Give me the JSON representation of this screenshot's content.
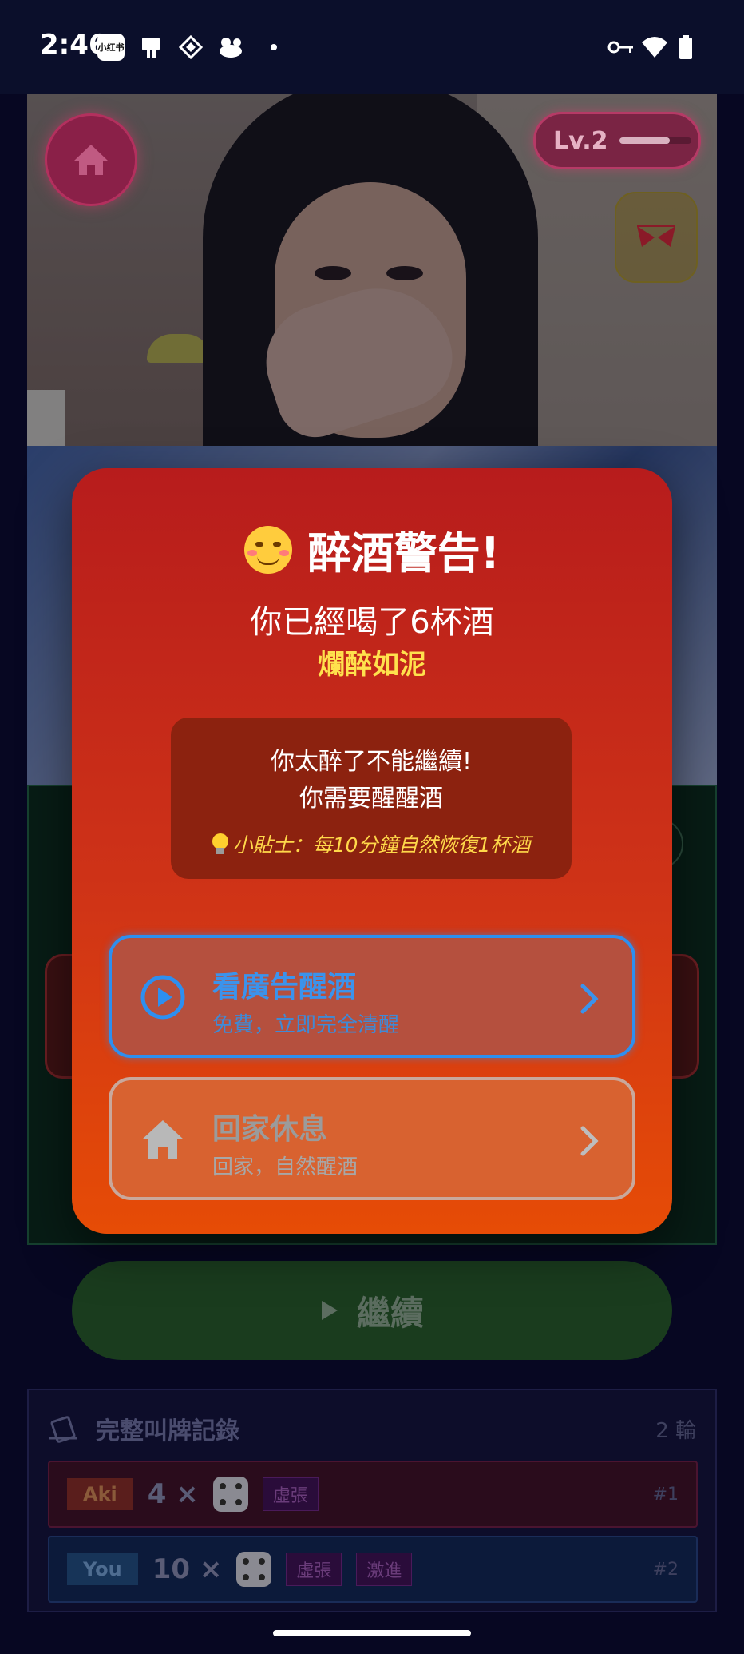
{
  "status_bar": {
    "time": "2:46",
    "app_badge": "小红书",
    "icons": [
      "xiaohongshu-icon",
      "tablet-icon",
      "diamond-grid-icon",
      "duck-icon",
      "dot-icon",
      "vpn-key-icon",
      "wifi-icon",
      "battery-icon"
    ]
  },
  "character": {
    "level_label": "Lv.2",
    "level_progress": 0.7
  },
  "dialog": {
    "title": "醉酒警告!",
    "drinks_text": "你已經喝了6杯酒",
    "drunk_status": "爛醉如泥",
    "warning_line1": "你太醉了不能繼續!",
    "warning_line2": "你需要醒醒酒",
    "tip": "小貼士：每10分鐘自然恢復1杯酒",
    "options": [
      {
        "title": "看廣告醒酒",
        "desc": "免費，立即完全清醒",
        "color": "#2d8ff0"
      },
      {
        "title": "回家休息",
        "desc": "回家，自然醒酒",
        "color": "#c9a89c"
      }
    ]
  },
  "continue_button": {
    "label": "繼續"
  },
  "history": {
    "title": "完整叫牌記錄",
    "round_count": "2 輪",
    "rows": [
      {
        "player": "Aki",
        "quantity": "4 ×",
        "tags": [
          "虛張"
        ],
        "index": "#1"
      },
      {
        "player": "You",
        "quantity": "10 ×",
        "tags": [
          "虛張",
          "激進"
        ],
        "index": "#2"
      }
    ]
  },
  "colors": {
    "dialog_top": "#b71c1c",
    "dialog_bottom": "#e64c06",
    "status_yellow": "#ffe14d",
    "ad_accent": "#2d8ff0"
  }
}
